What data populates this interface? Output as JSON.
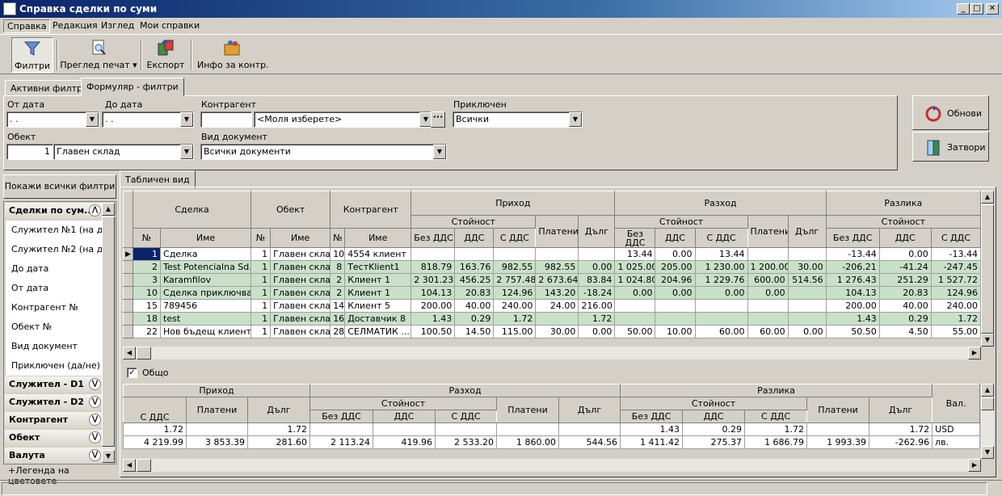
{
  "window": {
    "title": "Справка сделки по суми",
    "min": "_",
    "max": "□",
    "close": "✕"
  },
  "menu": [
    "Справка",
    "Редакция",
    "Изглед",
    "Мои справки"
  ],
  "toolbar": {
    "filters": "Филтри",
    "print_preview": "Преглед печат",
    "export": "Експорт",
    "info": "Инфо за контр."
  },
  "tabs": {
    "active_filters": "Активни филтри",
    "form_filters": "Формуляр - филтри"
  },
  "filters": {
    "from_date_label": "От дата",
    "from_date_value": " .  .",
    "to_date_label": "До дата",
    "to_date_value": " .  .",
    "contractor_label": "Контрагент",
    "contractor_code": "",
    "contractor_value": "<Моля изберете>",
    "contractor_more": "···",
    "case_label": "Приключен",
    "case_value": "Всички",
    "object_label": "Обект",
    "object_code": "1",
    "object_value": "Главен склад",
    "doc_type_label": "Вид документ",
    "doc_type_value": "Всички документи"
  },
  "buttons": {
    "refresh": "Обнови",
    "close": "Затвори"
  },
  "left": {
    "show_all": "Покажи всички филтри",
    "group_open": "Сделки по сум...",
    "items": [
      "Служител №1 (на док.",
      "Служител №2 (на док.",
      "До дата",
      "От дата",
      "Контрагент №",
      "Обект №",
      "Вид документ",
      "Приключен (да/не)"
    ],
    "groups": [
      "Служител - D1",
      "Служител - D2",
      "Контрагент",
      "Обект",
      "Валута"
    ],
    "legend": "+Легенда на цветовете"
  },
  "grid_tab": "Табличен вид",
  "grid": {
    "h_deal": "Сделка",
    "h_object": "Обект",
    "h_contr": "Контрагент",
    "h_income": "Приход",
    "h_expense": "Разход",
    "h_diff": "Разлика",
    "h_value": "Стойност",
    "h_paid": "Платени",
    "h_debt": "Дълг",
    "h_novat": "Без ДДС",
    "h_novat2": "Без\nДДС",
    "h_vat": "ДДС",
    "h_withvat": "С ДДС",
    "h_no": "№",
    "h_name": "Име",
    "rows": [
      {
        "n": "1",
        "name": "Сделка",
        "on": "1",
        "obj": "Главен склад",
        "cn": "10",
        "contr": "4554 клиент",
        "i1": "",
        "i2": "",
        "i3": "",
        "ip": "",
        "id": "",
        "e1": "13.44",
        "e2": "0.00",
        "e3": "13.44",
        "ep": "",
        "ed": "",
        "d1": "-13.44",
        "d2": "0.00",
        "d3": "-13.44",
        "green": false,
        "sel": true
      },
      {
        "n": "2",
        "name": "Test Potencialna Sd...",
        "on": "1",
        "obj": "Главен склад",
        "cn": "8",
        "contr": "ТестKlient1",
        "i1": "818.79",
        "i2": "163.76",
        "i3": "982.55",
        "ip": "982.55",
        "id": "0.00",
        "e1": "1 025.00",
        "e2": "205.00",
        "e3": "1 230.00",
        "ep": "1 200.00",
        "ed": "30.00",
        "d1": "-206.21",
        "d2": "-41.24",
        "d3": "-247.45",
        "green": true,
        "sel": false
      },
      {
        "n": "3",
        "name": "Karamfilov",
        "on": "1",
        "obj": "Главен склад",
        "cn": "2",
        "contr": "Клиент 1",
        "i1": "2 301.23",
        "i2": "456.25",
        "i3": "2 757.48",
        "ip": "2 673.64",
        "id": "83.84",
        "e1": "1 024.80",
        "e2": "204.96",
        "e3": "1 229.76",
        "ep": "600.00",
        "ed": "514.56",
        "d1": "1 276.43",
        "d2": "251.29",
        "d3": "1 527.72",
        "green": true,
        "sel": false
      },
      {
        "n": "10",
        "name": "Сделка приключване",
        "on": "1",
        "obj": "Главен склад",
        "cn": "2",
        "contr": "Клиент 1",
        "i1": "104.13",
        "i2": "20.83",
        "i3": "124.96",
        "ip": "143.20",
        "id": "-18.24",
        "e1": "0.00",
        "e2": "0.00",
        "e3": "0.00",
        "ep": "0.00",
        "ed": "",
        "d1": "104.13",
        "d2": "20.83",
        "d3": "124.96",
        "green": true,
        "sel": false
      },
      {
        "n": "15",
        "name": "789456",
        "on": "1",
        "obj": "Главен склад",
        "cn": "14",
        "contr": "Клиент 5",
        "i1": "200.00",
        "i2": "40.00",
        "i3": "240.00",
        "ip": "24.00",
        "id": "216.00",
        "e1": "",
        "e2": "",
        "e3": "",
        "ep": "",
        "ed": "",
        "d1": "200.00",
        "d2": "40.00",
        "d3": "240.00",
        "green": false,
        "sel": false
      },
      {
        "n": "18",
        "name": "test",
        "on": "1",
        "obj": "Главен склад",
        "cn": "16",
        "contr": "Доставчик 8",
        "i1": "1.43",
        "i2": "0.29",
        "i3": "1.72",
        "ip": "",
        "id": "1.72",
        "e1": "",
        "e2": "",
        "e3": "",
        "ep": "",
        "ed": "",
        "d1": "1.43",
        "d2": "0.29",
        "d3": "1.72",
        "green": true,
        "sel": false
      },
      {
        "n": "22",
        "name": "Нов бъдещ клиент",
        "on": "1",
        "obj": "Главен склад",
        "cn": "28",
        "contr": "СЕЛМАТИК ...",
        "i1": "100.50",
        "i2": "14.50",
        "i3": "115.00",
        "ip": "30.00",
        "id": "0.00",
        "e1": "50.00",
        "e2": "10.00",
        "e3": "60.00",
        "ep": "60.00",
        "ed": "0.00",
        "d1": "50.50",
        "d2": "4.50",
        "d3": "55.00",
        "green": false,
        "sel": false
      }
    ]
  },
  "total_label": "Общо",
  "totals": {
    "h_currency": "Вал.",
    "rows": [
      {
        "i3": "1.72",
        "ip": "",
        "id": "1.72",
        "e1": "",
        "e2": "",
        "e3": "",
        "ep": "",
        "ed": "",
        "d1": "1.43",
        "d2": "0.29",
        "d3": "1.72",
        "dp": "",
        "dd": "1.72",
        "cur": "USD"
      },
      {
        "i3": "4 219.99",
        "ip": "3 853.39",
        "id": "281.60",
        "e1": "2 113.24",
        "e2": "419.96",
        "e3": "2 533.20",
        "ep": "1 860.00",
        "ed": "544.56",
        "d1": "1 411.42",
        "d2": "275.37",
        "d3": "1 686.79",
        "dp": "1 993.39",
        "dd": "-262.96",
        "cur": "лв."
      }
    ]
  }
}
